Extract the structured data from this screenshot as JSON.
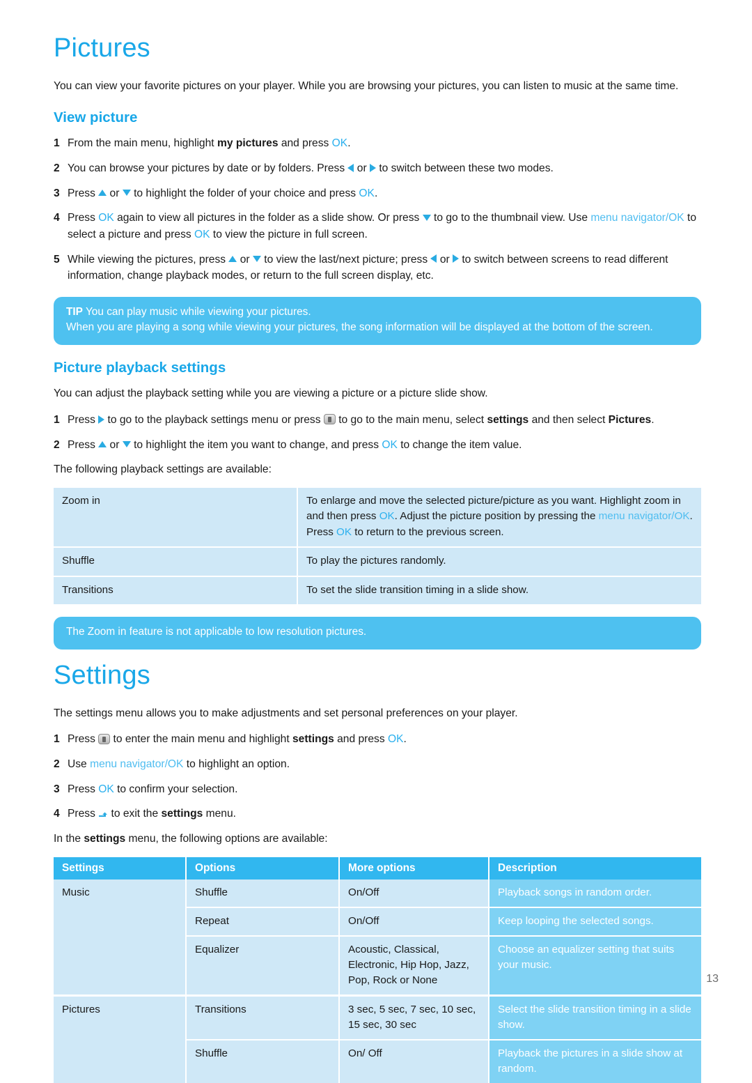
{
  "page": {
    "number": "13"
  },
  "colors": {
    "accent_blue": "#19A7E8",
    "link_blue": "#4FBDF0",
    "ok_blue": "#2BB0EE",
    "callout_bg": "#4EC1F0",
    "table_cell_bg": "#CFE8F7",
    "table_header_bg": "#31B7EF",
    "table_desc_bg": "#7FD2F4"
  },
  "pictures": {
    "heading": "Pictures",
    "intro": "You can view your favorite pictures on your player. While you are browsing your pictures, you can listen to music at the same time.",
    "view_picture": {
      "heading": "View picture",
      "steps": [
        {
          "num": "1",
          "parts": [
            {
              "t": "text",
              "v": "From the main menu, highlight "
            },
            {
              "t": "bold",
              "v": "my pictures"
            },
            {
              "t": "text",
              "v": " and press "
            },
            {
              "t": "ok",
              "v": "OK"
            },
            {
              "t": "text",
              "v": "."
            }
          ]
        },
        {
          "num": "2",
          "parts": [
            {
              "t": "text",
              "v": "You can browse your pictures by date or by folders. Press "
            },
            {
              "t": "arrow",
              "v": "left"
            },
            {
              "t": "text",
              "v": " or "
            },
            {
              "t": "arrow",
              "v": "right"
            },
            {
              "t": "text",
              "v": " to switch between these two modes."
            }
          ]
        },
        {
          "num": "3",
          "parts": [
            {
              "t": "text",
              "v": "Press "
            },
            {
              "t": "arrow",
              "v": "up"
            },
            {
              "t": "text",
              "v": " or "
            },
            {
              "t": "arrow",
              "v": "down"
            },
            {
              "t": "text",
              "v": " to highlight the folder of your choice and press "
            },
            {
              "t": "ok",
              "v": "OK"
            },
            {
              "t": "text",
              "v": "."
            }
          ]
        },
        {
          "num": "4",
          "parts": [
            {
              "t": "text",
              "v": "Press "
            },
            {
              "t": "ok",
              "v": "OK"
            },
            {
              "t": "text",
              "v": " again to view all pictures in the folder as a slide show. Or press "
            },
            {
              "t": "arrow",
              "v": "down"
            },
            {
              "t": "text",
              "v": " to go to the thumbnail view. Use "
            },
            {
              "t": "link",
              "v": "menu navigator/OK"
            },
            {
              "t": "text",
              "v": " to select a picture and press "
            },
            {
              "t": "ok",
              "v": "OK"
            },
            {
              "t": "text",
              "v": " to view the picture in full screen."
            }
          ]
        },
        {
          "num": "5",
          "parts": [
            {
              "t": "text",
              "v": "While viewing the pictures, press "
            },
            {
              "t": "arrow",
              "v": "up"
            },
            {
              "t": "text",
              "v": " or "
            },
            {
              "t": "arrow",
              "v": "down"
            },
            {
              "t": "text",
              "v": " to view the last/next picture; press "
            },
            {
              "t": "arrow",
              "v": "left"
            },
            {
              "t": "text",
              "v": " or "
            },
            {
              "t": "arrow",
              "v": "right"
            },
            {
              "t": "text",
              "v": " to switch between screens to read different information, change playback modes, or return to the full screen display, etc."
            }
          ]
        }
      ]
    },
    "tip": {
      "label": "TIP",
      "line1": " You can play music while viewing your pictures.",
      "line2": "When you are playing a song while viewing your pictures, the song information will be displayed at the bottom of the screen."
    },
    "playback_settings": {
      "heading": "Picture playback settings",
      "intro": "You can adjust the playback setting while you are viewing a picture or a picture slide show.",
      "steps": [
        {
          "num": "1",
          "parts": [
            {
              "t": "text",
              "v": "Press "
            },
            {
              "t": "arrow",
              "v": "right"
            },
            {
              "t": "text",
              "v": " to go to the playback settings menu or press "
            },
            {
              "t": "btnicon",
              "v": "menu-button-icon"
            },
            {
              "t": "text",
              "v": " to go to the main menu, select "
            },
            {
              "t": "bold",
              "v": "settings"
            },
            {
              "t": "text",
              "v": " and then select "
            },
            {
              "t": "bold",
              "v": "Pictures"
            },
            {
              "t": "text",
              "v": "."
            }
          ]
        },
        {
          "num": "2",
          "parts": [
            {
              "t": "text",
              "v": "Press "
            },
            {
              "t": "arrow",
              "v": "up"
            },
            {
              "t": "text",
              "v": " or "
            },
            {
              "t": "arrow",
              "v": "down"
            },
            {
              "t": "text",
              "v": " to highlight the item you want to change, and press "
            },
            {
              "t": "ok",
              "v": "OK"
            },
            {
              "t": "text",
              "v": " to change the item value."
            }
          ]
        }
      ],
      "table_intro": "The following playback settings are available:",
      "table": [
        {
          "name": "Zoom in",
          "desc_parts": [
            {
              "t": "text",
              "v": "To enlarge and move the selected picture/picture as you want. Highlight zoom in and then press "
            },
            {
              "t": "ok",
              "v": "OK"
            },
            {
              "t": "text",
              "v": ". Adjust the picture position by pressing the "
            },
            {
              "t": "link",
              "v": "menu navigator/OK"
            },
            {
              "t": "text",
              "v": ". Press "
            },
            {
              "t": "ok",
              "v": "OK"
            },
            {
              "t": "text",
              "v": " to return to the previous screen."
            }
          ]
        },
        {
          "name": "Shuffle",
          "desc_parts": [
            {
              "t": "text",
              "v": "To play the pictures randomly."
            }
          ]
        },
        {
          "name": "Transitions",
          "desc_parts": [
            {
              "t": "text",
              "v": "To set the slide transition timing in a slide show."
            }
          ]
        }
      ]
    },
    "note": "The Zoom in feature is not applicable to low resolution pictures."
  },
  "settings": {
    "heading": "Settings",
    "intro": "The settings menu allows you to make adjustments and set personal preferences on your player.",
    "steps": [
      {
        "num": "1",
        "parts": [
          {
            "t": "text",
            "v": "Press "
          },
          {
            "t": "btnicon",
            "v": "menu-button-icon"
          },
          {
            "t": "text",
            "v": " to enter the main menu and highlight "
          },
          {
            "t": "bold",
            "v": "settings"
          },
          {
            "t": "text",
            "v": " and press "
          },
          {
            "t": "ok",
            "v": "OK"
          },
          {
            "t": "text",
            "v": "."
          }
        ]
      },
      {
        "num": "2",
        "parts": [
          {
            "t": "text",
            "v": "Use "
          },
          {
            "t": "link",
            "v": "menu navigator/OK"
          },
          {
            "t": "text",
            "v": " to highlight an option."
          }
        ]
      },
      {
        "num": "3",
        "parts": [
          {
            "t": "text",
            "v": "Press "
          },
          {
            "t": "ok",
            "v": "OK"
          },
          {
            "t": "text",
            "v": " to confirm your selection."
          }
        ]
      },
      {
        "num": "4",
        "parts": [
          {
            "t": "text",
            "v": "Press "
          },
          {
            "t": "reticon",
            "v": "return-arrow-icon"
          },
          {
            "t": "text",
            "v": " to exit the "
          },
          {
            "t": "bold",
            "v": "settings"
          },
          {
            "t": "text",
            "v": " menu."
          }
        ]
      }
    ],
    "table_intro_parts": [
      {
        "t": "text",
        "v": "In the "
      },
      {
        "t": "bold",
        "v": "settings"
      },
      {
        "t": "text",
        "v": " menu, the following options are available:"
      }
    ],
    "table": {
      "headers": [
        "Settings",
        "Options",
        "More options",
        "Description"
      ],
      "rows": [
        {
          "setting": "Music",
          "setting_rowspan": 3,
          "option": "Shuffle",
          "more": "On/Off",
          "description": "Playback songs in random order.",
          "group_start": true
        },
        {
          "setting": "",
          "option": "Repeat",
          "more": "On/Off",
          "description": "Keep looping the selected songs.",
          "group_start": false
        },
        {
          "setting": "",
          "option": "Equalizer",
          "more": "Acoustic,  Classical, Electronic, Hip Hop, Jazz, Pop, Rock or None",
          "description": "Choose an equalizer setting that suits your music.",
          "group_start": false
        },
        {
          "setting": "Pictures",
          "setting_rowspan": 2,
          "option": "Transitions",
          "more": "3 sec, 5 sec, 7 sec, 10 sec, 15 sec, 30 sec",
          "description": "Select the slide transition timing in a slide show.",
          "group_start": true
        },
        {
          "setting": "",
          "option": "Shuffle",
          "more": "On/ Off",
          "description": "Playback the pictures in a slide show at random.",
          "group_start": false
        }
      ]
    }
  }
}
